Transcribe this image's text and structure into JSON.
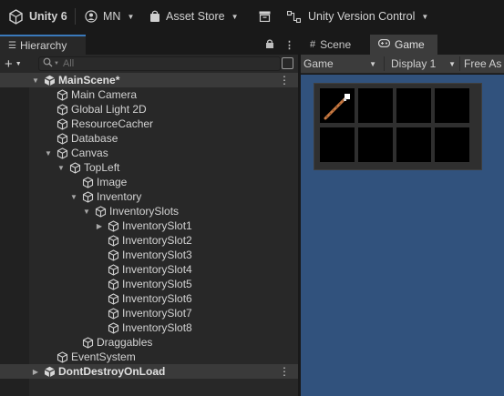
{
  "toolbar": {
    "unity_label": "Unity 6",
    "account_label": "MN",
    "asset_store_label": "Asset Store",
    "version_control_label": "Unity Version Control"
  },
  "hierarchy": {
    "tab_label": "Hierarchy",
    "search_placeholder": "All",
    "rows": [
      {
        "label": "MainScene*",
        "depth": 0,
        "expanded": true,
        "type": "scene"
      },
      {
        "label": "Main Camera",
        "depth": 1,
        "type": "gameobject"
      },
      {
        "label": "Global Light 2D",
        "depth": 1,
        "type": "gameobject"
      },
      {
        "label": "ResourceCacher",
        "depth": 1,
        "type": "gameobject"
      },
      {
        "label": "Database",
        "depth": 1,
        "type": "gameobject"
      },
      {
        "label": "Canvas",
        "depth": 1,
        "expanded": true,
        "type": "gameobject"
      },
      {
        "label": "TopLeft",
        "depth": 2,
        "expanded": true,
        "type": "gameobject"
      },
      {
        "label": "Image",
        "depth": 3,
        "type": "gameobject"
      },
      {
        "label": "Inventory",
        "depth": 3,
        "expanded": true,
        "type": "gameobject"
      },
      {
        "label": "InventorySlots",
        "depth": 4,
        "expanded": true,
        "type": "gameobject"
      },
      {
        "label": "InventorySlot1",
        "depth": 5,
        "expanded": false,
        "type": "gameobject"
      },
      {
        "label": "InventorySlot2",
        "depth": 5,
        "type": "gameobject"
      },
      {
        "label": "InventorySlot3",
        "depth": 5,
        "type": "gameobject"
      },
      {
        "label": "InventorySlot4",
        "depth": 5,
        "type": "gameobject"
      },
      {
        "label": "InventorySlot5",
        "depth": 5,
        "type": "gameobject"
      },
      {
        "label": "InventorySlot6",
        "depth": 5,
        "type": "gameobject"
      },
      {
        "label": "InventorySlot7",
        "depth": 5,
        "type": "gameobject"
      },
      {
        "label": "InventorySlot8",
        "depth": 5,
        "type": "gameobject"
      },
      {
        "label": "Draggables",
        "depth": 3,
        "type": "gameobject"
      },
      {
        "label": "EventSystem",
        "depth": 1,
        "type": "gameobject"
      },
      {
        "label": "DontDestroyOnLoad",
        "depth": 0,
        "expanded": false,
        "type": "scene"
      }
    ]
  },
  "scene_view": {
    "scene_tab_label": "Scene",
    "game_tab_label": "Game"
  },
  "game_view": {
    "view_dropdown": "Game",
    "display_dropdown": "Display 1",
    "aspect_dropdown": "Free As",
    "inventory_slot_count": 8,
    "occupied_slot_item": "wand-icon"
  },
  "colors": {
    "panel_bg": "#282828",
    "toolbar_bg": "#191919",
    "game_bg": "#31527d",
    "tab_accent": "#3a79bb",
    "slot_bg": "#000000",
    "inventory_frame": "#2f2f2f"
  }
}
